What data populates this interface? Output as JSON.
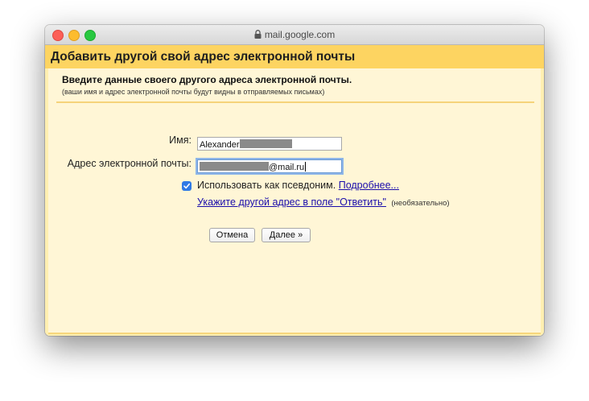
{
  "browser": {
    "url": "mail.google.com",
    "lock_icon": "lock-icon"
  },
  "dialog": {
    "title": "Добавить другой свой адрес электронной почты",
    "intro_title": "Введите данные своего другого адреса электронной почты.",
    "intro_note": "(ваши имя и адрес электронной почты будут видны в отправляемых письмах)",
    "name_label": "Имя:",
    "name_value": "Alexander",
    "email_label": "Адрес электронной почты:",
    "email_value": "@mail.ru",
    "alias_checked": true,
    "alias_label": "Использовать как псевдоним.",
    "more_link": "Подробнее...",
    "reply_link": "Укажите другой адрес в поле \"Ответить\"",
    "reply_optional": "(необязательно)",
    "cancel_label": "Отмена",
    "next_label": "Далее »"
  },
  "colors": {
    "header": "#fdd461",
    "panel": "#fff6d6",
    "link": "#1a0dab",
    "checkbox": "#2f7ae5"
  }
}
